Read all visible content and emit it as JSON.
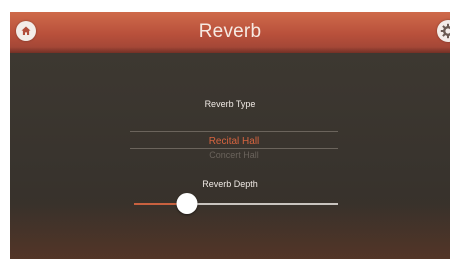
{
  "header": {
    "title": "Reverb",
    "home_icon": "home-icon",
    "settings_icon": "settings-icon"
  },
  "reverb_type": {
    "label": "Reverb Type",
    "selected": "Recital Hall",
    "next_option": "Concert Hall"
  },
  "reverb_depth": {
    "label": "Reverb Depth",
    "value_fraction": 0.26
  },
  "colors": {
    "accent": "#d7643f",
    "header": "#b8503b",
    "background": "#3b3630"
  }
}
